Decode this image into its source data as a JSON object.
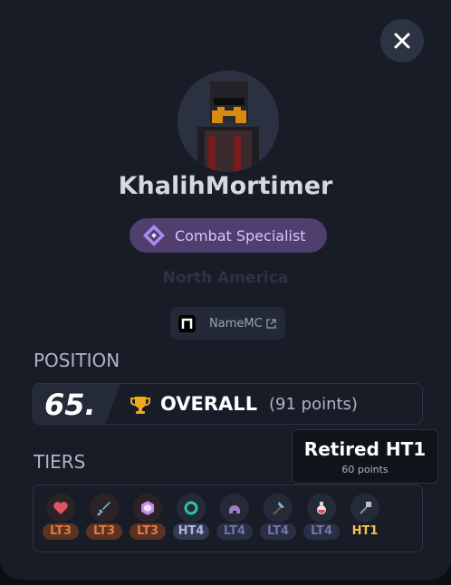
{
  "player": {
    "username": "KhalihMortimer",
    "title": "Combat Specialist",
    "region": "North America",
    "namemc_label": "NameMC"
  },
  "position": {
    "section_title": "POSITION",
    "rank": "65.",
    "category": "OVERALL",
    "points_text": "(91 points)"
  },
  "tiers": {
    "section_title": "TIERS",
    "items": [
      {
        "icon": "heart-icon",
        "label": "LT3",
        "color": "#d65d2e"
      },
      {
        "icon": "sword-icon",
        "label": "LT3",
        "color": "#d65d2e"
      },
      {
        "icon": "crystal-icon",
        "label": "LT3",
        "color": "#d65d2e"
      },
      {
        "icon": "ring-icon",
        "label": "HT4",
        "color": "#9da6d9"
      },
      {
        "icon": "helmet-icon",
        "label": "LT4",
        "color": "#6d6ea3"
      },
      {
        "icon": "axe-icon",
        "label": "LT4",
        "color": "#6d6ea3"
      },
      {
        "icon": "potion-icon",
        "label": "LT4",
        "color": "#6d6ea3"
      },
      {
        "icon": "mace-icon",
        "label": "HT1",
        "color": "#f2c14b"
      }
    ]
  },
  "tooltip": {
    "title": "Retired HT1",
    "subtitle": "60 points"
  }
}
